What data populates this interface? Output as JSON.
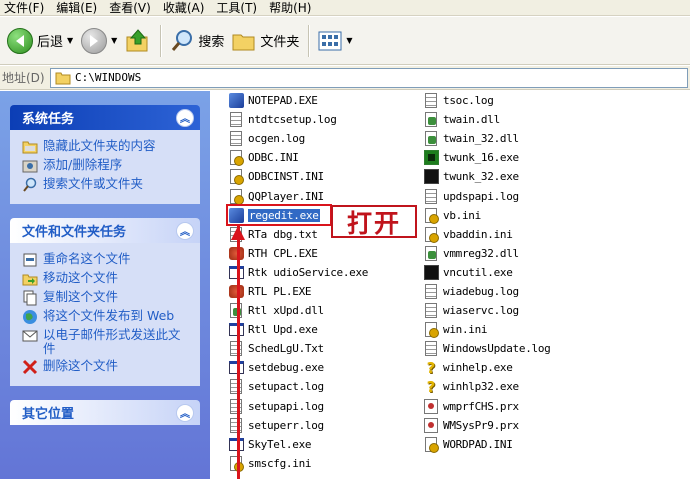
{
  "menubar": {
    "items": [
      "文件(F)",
      "编辑(E)",
      "查看(V)",
      "收藏(A)",
      "工具(T)",
      "帮助(H)"
    ]
  },
  "toolbar": {
    "back_label": "后退",
    "search_label": "搜索",
    "folders_label": "文件夹"
  },
  "address": {
    "label": "地址(D)",
    "path": "C:\\WINDOWS"
  },
  "taskpane": {
    "system_tasks": {
      "title": "系统任务",
      "items": [
        "隐藏此文件夹的内容",
        "添加/删除程序",
        "搜索文件或文件夹"
      ]
    },
    "file_tasks": {
      "title": "文件和文件夹任务",
      "items": [
        "重命名这个文件",
        "移动这个文件",
        "复制这个文件",
        "将这个文件发布到 Web",
        "以电子邮件形式发送此文件",
        "删除这个文件"
      ]
    },
    "other_places": {
      "title": "其它位置"
    }
  },
  "files": {
    "col1": [
      {
        "name": "NOTEPAD.EXE",
        "icon": "notepad-icon"
      },
      {
        "name": "ntdtcsetup.log",
        "icon": "text-file-icon"
      },
      {
        "name": "ocgen.log",
        "icon": "text-file-icon"
      },
      {
        "name": "ODBC.INI",
        "icon": "config-file-icon"
      },
      {
        "name": "ODBCINST.INI",
        "icon": "config-file-icon"
      },
      {
        "name": "QQPlayer.INI",
        "icon": "config-file-icon"
      },
      {
        "name": "regedit.exe",
        "icon": "regedit-icon",
        "selected": true
      },
      {
        "name": "RTa  dbg.txt",
        "icon": "text-file-icon"
      },
      {
        "name": "RTH  CPL.EXE",
        "icon": "speaker-icon"
      },
      {
        "name": "Rtk  udioService.exe",
        "icon": "window-app-icon"
      },
      {
        "name": "RTL  PL.EXE",
        "icon": "speaker-icon"
      },
      {
        "name": "Rtl  xUpd.dll",
        "icon": "dll-icon"
      },
      {
        "name": "Rtl  Upd.exe",
        "icon": "app-icon"
      },
      {
        "name": "SchedLgU.Txt",
        "icon": "text-file-icon"
      },
      {
        "name": "setdebug.exe",
        "icon": "app-icon"
      },
      {
        "name": "setupact.log",
        "icon": "text-file-icon"
      },
      {
        "name": "setupapi.log",
        "icon": "text-file-icon"
      },
      {
        "name": "setuperr.log",
        "icon": "text-file-icon"
      },
      {
        "name": "SkyTel.exe",
        "icon": "app-icon"
      },
      {
        "name": "smscfg.ini",
        "icon": "config-file-icon"
      }
    ],
    "col2": [
      {
        "name": "tsoc.log",
        "icon": "text-file-icon"
      },
      {
        "name": "twain.dll",
        "icon": "dll-icon"
      },
      {
        "name": "twain_32.dll",
        "icon": "dll-icon"
      },
      {
        "name": "twunk_16.exe",
        "icon": "scanner-icon"
      },
      {
        "name": "twunk_32.exe",
        "icon": "terminal-icon"
      },
      {
        "name": "updspapi.log",
        "icon": "text-file-icon"
      },
      {
        "name": "vb.ini",
        "icon": "config-file-icon"
      },
      {
        "name": "vbaddin.ini",
        "icon": "config-file-icon"
      },
      {
        "name": "vmmreg32.dll",
        "icon": "dll-icon"
      },
      {
        "name": "vncutil.exe",
        "icon": "terminal-icon"
      },
      {
        "name": "wiadebug.log",
        "icon": "text-file-icon"
      },
      {
        "name": "wiaservc.log",
        "icon": "text-file-icon"
      },
      {
        "name": "win.ini",
        "icon": "config-file-icon"
      },
      {
        "name": "WindowsUpdate.log",
        "icon": "text-file-icon"
      },
      {
        "name": "winhelp.exe",
        "icon": "help-icon"
      },
      {
        "name": "winhlp32.exe",
        "icon": "help-icon"
      },
      {
        "name": "wmprfCHS.prx",
        "icon": "media-file-icon"
      },
      {
        "name": "WMSysPr9.prx",
        "icon": "media-file-icon"
      },
      {
        "name": "WORDPAD.INI",
        "icon": "config-file-icon"
      }
    ]
  },
  "annotation": {
    "label": "打开"
  }
}
